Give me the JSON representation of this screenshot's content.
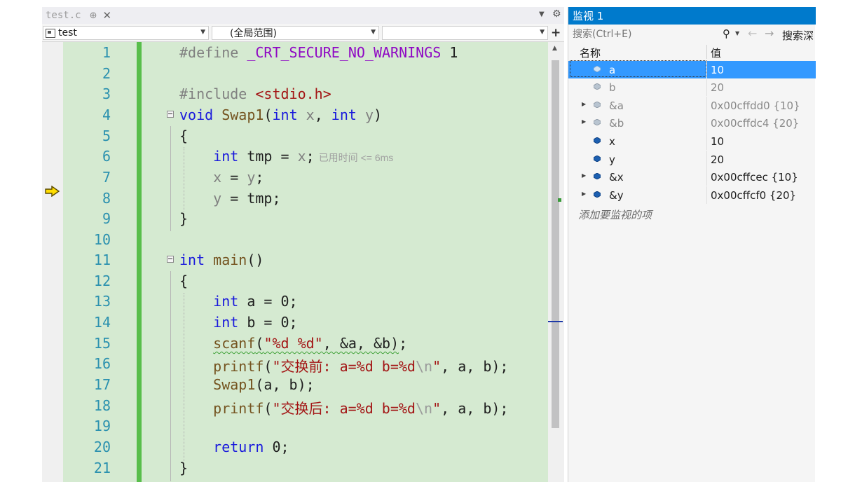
{
  "editor": {
    "tab": {
      "name": "test.c",
      "pin": "⊕",
      "close": "✕"
    },
    "project_combo": "test",
    "scope_combo": "(全局范围)",
    "member_combo": "",
    "exec_hint": "已用时间 <= 6ms",
    "lines": [
      "1",
      "2",
      "3",
      "4",
      "5",
      "6",
      "7",
      "8",
      "9",
      "10",
      "11",
      "12",
      "13",
      "14",
      "15",
      "16",
      "17",
      "18",
      "19",
      "20",
      "21"
    ]
  },
  "watch": {
    "title": "监视 1",
    "search_placeholder": "搜索(Ctrl+E)",
    "search_depth": "搜索深",
    "col_name": "名称",
    "col_value": "值",
    "rows": [
      {
        "name": "a",
        "value": "10"
      },
      {
        "name": "b",
        "value": "20"
      },
      {
        "name": "&a",
        "value": "0x00cffdd0 {10}"
      },
      {
        "name": "&b",
        "value": "0x00cffdc4 {20}"
      },
      {
        "name": "x",
        "value": "10"
      },
      {
        "name": "y",
        "value": "20"
      },
      {
        "name": "&x",
        "value": "0x00cffcec {10}"
      },
      {
        "name": "&y",
        "value": "0x00cffcf0 {20}"
      }
    ],
    "add_item": "添加要监视的项"
  },
  "colors": {
    "accent": "#007acc",
    "selection": "#3399ff",
    "code_bg": "#d5ead1",
    "change_bar": "#58be4b",
    "keyword": "#1a1adc",
    "string": "#a31515",
    "line_number": "#2b91af"
  }
}
